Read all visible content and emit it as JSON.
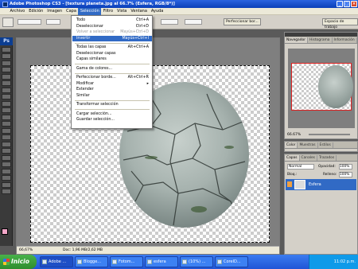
{
  "window": {
    "title": "Adobe Photoshop CS3 - [textura planeta.jpg al 66.7% (Esfera, RGB/8*)]",
    "min": "_",
    "max": "□",
    "close": "×"
  },
  "menubar": {
    "items": [
      "Archivo",
      "Edición",
      "Imagen",
      "Capa",
      "Selección",
      "Filtro",
      "Vista",
      "Ventana",
      "Ayuda"
    ],
    "active_index": 4
  },
  "options": {
    "refine_label": "Perfeccionar bor...",
    "workspace_label": "Espacio de trabajo"
  },
  "selection_menu": [
    {
      "label": "Todo",
      "shortcut": "Ctrl+A",
      "state": "normal"
    },
    {
      "label": "Deseleccionar",
      "shortcut": "Ctrl+D",
      "state": "normal"
    },
    {
      "label": "Volver a seleccionar",
      "shortcut": "Mayús+Ctrl+D",
      "state": "disabled"
    },
    {
      "label": "Invertir",
      "shortcut": "Mayús+Ctrl+I",
      "state": "hover"
    },
    {
      "label": "Todas las capas",
      "shortcut": "Alt+Ctrl+A",
      "state": "normal"
    },
    {
      "label": "Deseleccionar capas",
      "shortcut": "",
      "state": "normal"
    },
    {
      "label": "Capas similares",
      "shortcut": "",
      "state": "normal"
    },
    {
      "label": "Gama de colores...",
      "shortcut": "",
      "state": "normal"
    },
    {
      "label": "Perfeccionar borde...",
      "shortcut": "Alt+Ctrl+R",
      "state": "normal"
    },
    {
      "label": "Modificar",
      "shortcut": "▸",
      "state": "normal"
    },
    {
      "label": "Extender",
      "shortcut": "",
      "state": "normal"
    },
    {
      "label": "Similar",
      "shortcut": "",
      "state": "normal"
    },
    {
      "label": "Transformar selección",
      "shortcut": "",
      "state": "normal"
    },
    {
      "label": "Cargar selección...",
      "shortcut": "",
      "state": "normal"
    },
    {
      "label": "Guardar selección...",
      "shortcut": "",
      "state": "normal"
    }
  ],
  "document": {
    "zoom": "66,67%",
    "doc_info": "Doc: 1,96 MB/2,62 MB"
  },
  "navigator": {
    "tabs": [
      "Navegador",
      "Histograma",
      "Información"
    ],
    "zoom": "66.67%"
  },
  "color_panel": {
    "tabs": [
      "Color",
      "Muestras",
      "Estilos"
    ]
  },
  "layers": {
    "tabs": [
      "Capas",
      "Canales",
      "Trazados"
    ],
    "blend_mode": "Normal",
    "opacity_label": "Opacidad:",
    "opacity": "100%",
    "lock_label": "Bloq.:",
    "fill_label": "Relleno:",
    "fill": "100%",
    "layer_name": "Esfera"
  },
  "taskbar": {
    "start": "Inicio",
    "tasks": [
      {
        "label": "Adobe ...",
        "active": true
      },
      {
        "label": "Blogge...",
        "active": false
      },
      {
        "label": "Fotom...",
        "active": false
      },
      {
        "label": "esfera",
        "active": false
      },
      {
        "label": "(10%) ...",
        "active": false
      },
      {
        "label": "CorelD...",
        "active": false
      }
    ],
    "clock": "11:02 p.m."
  },
  "colors": {
    "accent": "#316ac5",
    "title_bar": "#0a3fb8",
    "taskbar": "#1f55d6",
    "start_green": "#3b9b3b",
    "fg_swatch": "#f3a7c8"
  }
}
